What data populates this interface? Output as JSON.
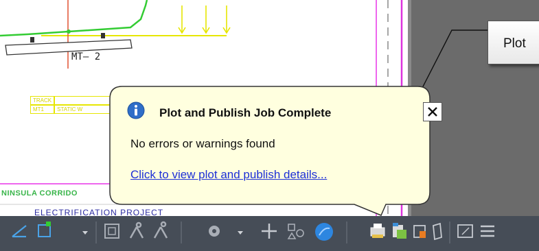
{
  "drawing": {
    "label_mt2": "MT– 2",
    "track_header": "TRACK",
    "track_row": [
      "MT1",
      "STATIC  W"
    ],
    "corridor_text": "NINSULA CORRIDO",
    "project_text": "ELECTRIFICATION  PROJECT"
  },
  "callout": {
    "text": "Plot"
  },
  "notification": {
    "title": "Plot and Publish Job Complete",
    "message": "No errors or warnings found",
    "link": "Click to view plot and publish details...",
    "icon": "info-icon",
    "close_icon": "close-icon"
  },
  "statusbar": {
    "items": [
      {
        "name": "dynamic-ucs-icon"
      },
      {
        "name": "selection-cycling-icon"
      },
      {
        "name": "selection-dropdown-icon"
      },
      {
        "name": "show-viewport-icon"
      },
      {
        "name": "annotation-visibility-icon"
      },
      {
        "name": "annotation-scale-icon"
      },
      {
        "name": "workspace-gear-icon"
      },
      {
        "name": "workspace-dropdown-icon"
      },
      {
        "name": "annotation-monitor-plus-icon"
      },
      {
        "name": "units-icon"
      },
      {
        "name": "quick-properties-icon"
      },
      {
        "name": "plot-publish-printer-icon"
      },
      {
        "name": "plot-publish-details-icon"
      },
      {
        "name": "communication-center-icon"
      },
      {
        "name": "isolate-objects-icon"
      },
      {
        "name": "fullscreen-icon"
      },
      {
        "name": "customize-menu-icon"
      }
    ]
  },
  "colors": {
    "status_bar": "#464d57",
    "balloon_fill": "#ffffdf",
    "link": "#1d2fd6",
    "grey_canvas": "#6b6b6b"
  }
}
